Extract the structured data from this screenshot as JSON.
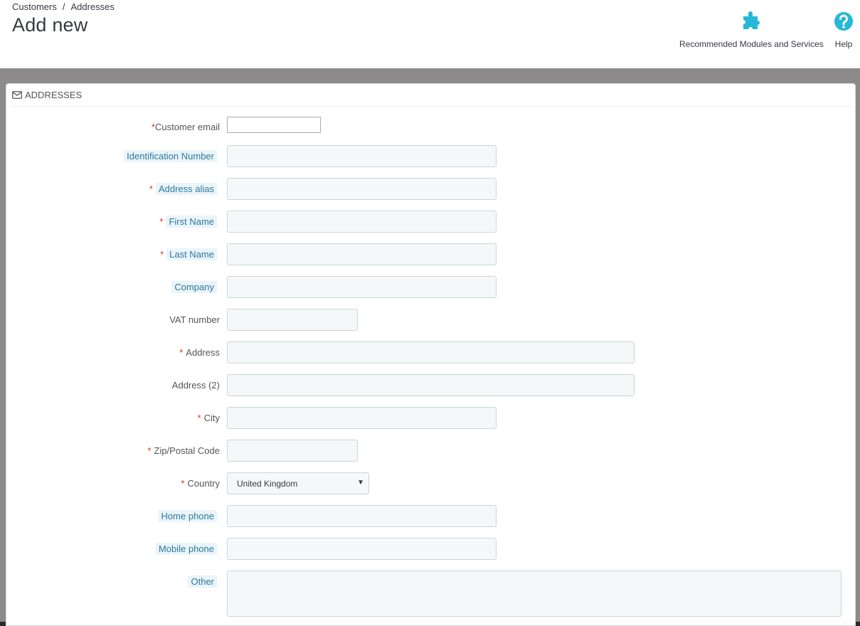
{
  "breadcrumb": {
    "items": [
      "Customers",
      "Addresses"
    ],
    "separator": "/"
  },
  "page_title": "Add new",
  "toolbar": {
    "modules_label": "Recommended Modules and Services",
    "help_label": "Help"
  },
  "panel": {
    "heading": "ADDRESSES"
  },
  "form": {
    "customer_email": {
      "label": "Customer email",
      "required": "*",
      "value": ""
    },
    "identification_number": {
      "label": "Identification Number",
      "value": ""
    },
    "address_alias": {
      "label": "Address alias",
      "required": "*",
      "value": ""
    },
    "first_name": {
      "label": "First Name",
      "required": "*",
      "value": ""
    },
    "last_name": {
      "label": "Last Name",
      "required": "*",
      "value": ""
    },
    "company": {
      "label": "Company",
      "value": ""
    },
    "vat_number": {
      "label": "VAT number",
      "value": ""
    },
    "address": {
      "label": "Address",
      "required": "*",
      "value": ""
    },
    "address2": {
      "label": "Address (2)",
      "value": ""
    },
    "city": {
      "label": "City",
      "required": "*",
      "value": ""
    },
    "zip": {
      "label": "Zip/Postal Code",
      "required": "*",
      "value": ""
    },
    "country": {
      "label": "Country",
      "required": "*",
      "selected": "United Kingdom"
    },
    "home_phone": {
      "label": "Home phone",
      "value": ""
    },
    "mobile_phone": {
      "label": "Mobile phone",
      "value": ""
    },
    "other": {
      "label": "Other",
      "value": ""
    }
  },
  "colors": {
    "accent": "#25b9d7",
    "required": "#e0301e",
    "hint_text": "#2c7aa0",
    "hint_bg": "#eaf4f9",
    "backdrop": "#8c8a8b"
  },
  "icons": {
    "modules": "puzzle-icon",
    "help": "question-circle-icon",
    "panel": "envelope-icon",
    "select": "caret-down-icon"
  }
}
